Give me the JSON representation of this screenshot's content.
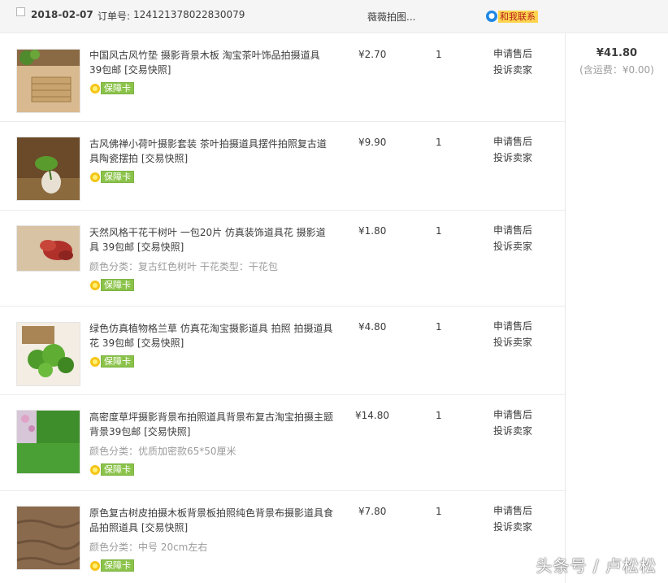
{
  "order": {
    "date": "2018-02-07",
    "order_no_label": "订单号:",
    "order_no": "124121378022830079",
    "shop_name": "薇薇拍图...",
    "contact_label": "和我联系"
  },
  "summary": {
    "total": "¥41.80",
    "shipping": "(含运费：¥0.00)"
  },
  "badge_label": "保障卡",
  "actions": {
    "after_sale": "申请售后",
    "complain": "投诉卖家"
  },
  "items": [
    {
      "title": "中国风古风竹垫 摄影背景木板 淘宝茶叶饰品拍摄道具 39包邮",
      "snapshot": "[交易快照]",
      "sku": "",
      "price": "¥2.70",
      "qty": "1"
    },
    {
      "title": "古风佛禅小荷叶摄影套装 茶叶拍摄道具摆件拍照复古道具陶瓷摆拍",
      "snapshot": "[交易快照]",
      "sku": "",
      "price": "¥9.90",
      "qty": "1"
    },
    {
      "title": "天然风格干花干树叶 一包20片 仿真装饰道具花 摄影道具 39包邮",
      "snapshot": "[交易快照]",
      "sku": "颜色分类：复古红色树叶   干花类型：干花包",
      "price": "¥1.80",
      "qty": "1"
    },
    {
      "title": "绿色仿真植物格兰草 仿真花淘宝摄影道具 拍照 拍摄道具花 39包邮",
      "snapshot": "[交易快照]",
      "sku": "",
      "price": "¥4.80",
      "qty": "1"
    },
    {
      "title": "高密度草坪摄影背景布拍照道具背景布复古淘宝拍摄主题背景39包邮",
      "snapshot": "[交易快照]",
      "sku": "颜色分类：优质加密款65*50厘米",
      "price": "¥14.80",
      "qty": "1"
    },
    {
      "title": "原色复古树皮拍摄木板背景板拍照纯色背景布摄影道具食品拍照道具",
      "snapshot": "[交易快照]",
      "sku": "颜色分类：中号 20cm左右",
      "price": "¥7.80",
      "qty": "1"
    }
  ],
  "watermark": "头条号 / 卢松松",
  "colors": {
    "badge_green": "#8bc34a",
    "contact_yellow": "#ffd54f",
    "contact_blue": "#1e88e5"
  }
}
